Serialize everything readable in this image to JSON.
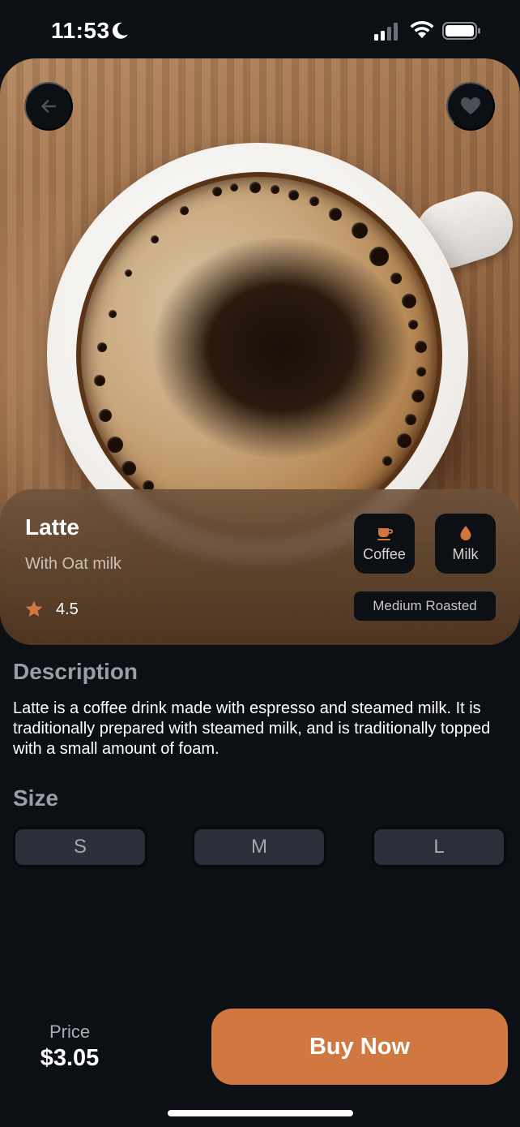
{
  "status_bar": {
    "time": "11:53"
  },
  "product": {
    "name": "Latte",
    "subtitle": "With Oat milk",
    "rating": "4.5",
    "features": [
      {
        "label": "Coffee",
        "icon": "coffee-cup-icon"
      },
      {
        "label": "Milk",
        "icon": "milk-drop-icon"
      }
    ],
    "roast": "Medium Roasted"
  },
  "description": {
    "heading": "Description",
    "text": "Latte is a coffee drink made with espresso and steamed milk. It is traditionally prepared with steamed milk, and is traditionally topped with a small amount of foam."
  },
  "size": {
    "heading": "Size",
    "options": [
      "S",
      "M",
      "L"
    ]
  },
  "footer": {
    "price_label": "Price",
    "price_value": "$3.05",
    "buy_label": "Buy Now"
  },
  "colors": {
    "accent": "#d17842",
    "background": "#0c0f14",
    "chip": "#2a2f3a"
  }
}
